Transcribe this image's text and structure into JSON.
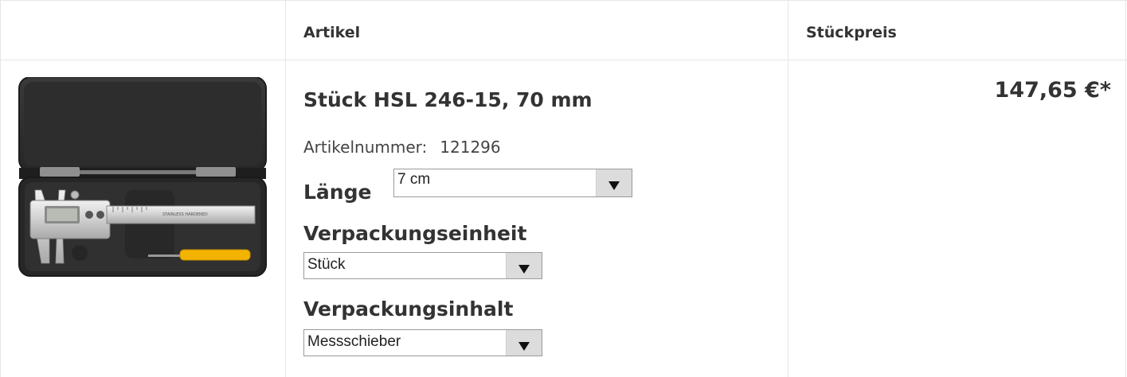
{
  "table": {
    "header": {
      "article": "Artikel",
      "unit_price": "Stückpreis"
    }
  },
  "product": {
    "title": "Stück HSL 246-15, 70 mm",
    "article_number_label": "Artikelnummer:",
    "article_number": "121296",
    "price": "147,65 €*",
    "image_label": "STAINLESS HARDENED",
    "options": {
      "length": {
        "label": "Länge",
        "value": "7 cm"
      },
      "packaging_unit": {
        "label": "Verpackungseinheit",
        "value": "Stück"
      },
      "packaging_content": {
        "label": "Verpackungsinhalt",
        "value": "Messschieber"
      }
    }
  }
}
